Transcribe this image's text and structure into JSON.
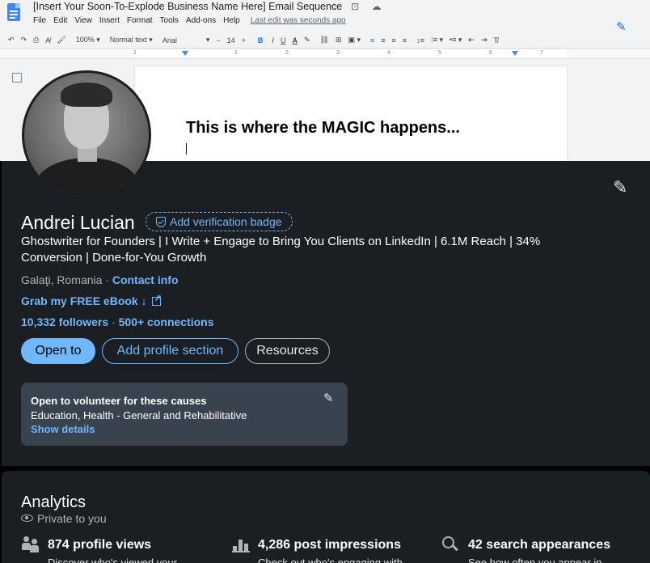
{
  "docs": {
    "title": "[Insert Your Soon-To-Explode Business Name Here] Email Sequence",
    "title_icons": "☆ ⊡ ☁",
    "menu": [
      "File",
      "Edit",
      "View",
      "Insert",
      "Format",
      "Tools",
      "Add-ons",
      "Help"
    ],
    "last_edit": "Last edit was seconds ago",
    "toolbar": {
      "undo": "↶",
      "redo": "↷",
      "print": "⎙",
      "spell": "A̸",
      "paint": "🖌",
      "zoom": "100% ▾",
      "style": "Normal text ▾",
      "font": "Arial",
      "font_caret": "▾",
      "minus": "−",
      "font_size": "14",
      "plus": "+",
      "bold": "B",
      "italic": "I",
      "underline": "U",
      "text_color": "A",
      "highlight": "✎",
      "link": "⛓",
      "comment": "⊞",
      "image": "▣ ▾",
      "align_left": "≡",
      "align_center": "≡",
      "align_right": "≡",
      "justify": "≡",
      "line_spacing": "↕≡",
      "numbered": "⁝≡ ▾",
      "bulleted": "•≡ ▾",
      "indent_less": "⇤",
      "indent_more": "⇥",
      "clear": "T̸"
    },
    "ruler_numbers": [
      "1",
      "1",
      "2",
      "3",
      "4",
      "5",
      "6",
      "7"
    ],
    "heading": "This is where the MAGIC happens..."
  },
  "profile": {
    "name": "Andrei Lucian",
    "verify_label": "Add verification badge",
    "headline": "Ghostwriter for Founders | I Write + Engage to Bring You Clients on LinkedIn | 6.1M Reach | 34% Conversion | Done-for-You Growth",
    "location": "Galaţi, Romania",
    "location_sep": " · ",
    "contact_info": "Contact info",
    "ebook_link": "Grab my FREE eBook ↓",
    "followers": "10,332 followers",
    "stats_sep": " · ",
    "connections": "500+ connections",
    "buttons": {
      "open_to": "Open to",
      "add_section": "Add profile section",
      "resources": "Resources"
    },
    "volunteer": {
      "title": "Open to volunteer for these causes",
      "causes": "Education, Health - General and Rehabilitative",
      "details": "Show details"
    }
  },
  "analytics": {
    "title": "Analytics",
    "privacy": "Private to you",
    "metrics": [
      {
        "label": "874 profile views",
        "sub": "Discover who's viewed your"
      },
      {
        "label": "4,286 post impressions",
        "sub": "Check out who's engaging with"
      },
      {
        "label": "42 search appearances",
        "sub": "See how often you appear in"
      }
    ]
  },
  "colors": {
    "linkedin_bg": "#1b1f23",
    "linkedin_accent": "#71b7fb",
    "card_bg": "#38434f",
    "docs_bg": "#f1f3f4",
    "docs_blue": "#4285f4"
  }
}
